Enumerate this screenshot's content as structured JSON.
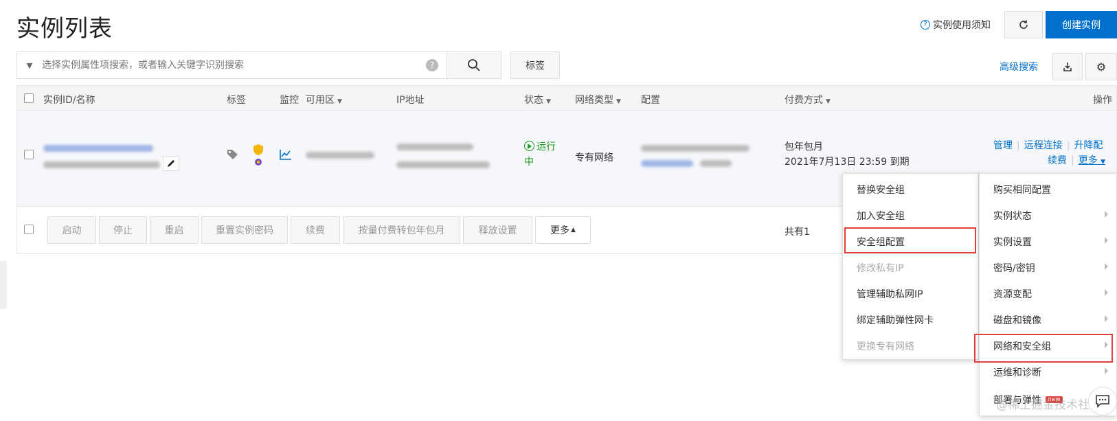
{
  "page": {
    "title": "实例列表"
  },
  "header": {
    "notice_label": "实例使用须知",
    "create_label": "创建实例"
  },
  "toolbar": {
    "search_placeholder": "选择实例属性项搜索，或者输入关键字识别搜索",
    "tag_label": "标签",
    "advanced_search_label": "高级搜索"
  },
  "table": {
    "columns": {
      "id_name": "实例ID/名称",
      "tags": "标签",
      "monitor": "监控",
      "zone": "可用区",
      "ip": "IP地址",
      "status": "状态",
      "network_type": "网络类型",
      "config": "配置",
      "billing": "付费方式",
      "actions": "操作"
    },
    "row": {
      "status": "运行中",
      "network_type": "专有网络",
      "billing_type": "包年包月",
      "expire_text": "2021年7月13日 23:59 到期",
      "actions": {
        "manage": "管理",
        "remote": "远程连接",
        "upgrade": "升降配",
        "renew": "续费",
        "more": "更多"
      }
    },
    "total_text": "共有1"
  },
  "batch_actions": {
    "start": "启动",
    "stop": "停止",
    "restart": "重启",
    "reset_password": "重置实例密码",
    "renew": "续费",
    "convert_billing": "按量付费转包年包月",
    "release": "释放设置",
    "more": "更多"
  },
  "more_menu": {
    "items": [
      "购买相同配置",
      "实例状态",
      "实例设置",
      "密码/密钥",
      "资源变配",
      "磁盘和镜像",
      "网络和安全组",
      "运维和诊断",
      "部署与弹性"
    ],
    "new_badge": "new"
  },
  "sub_menu": {
    "items": [
      "替换安全组",
      "加入安全组",
      "安全组配置",
      "修改私有IP",
      "管理辅助私网IP",
      "绑定辅助弹性网卡",
      "更换专有网络"
    ]
  },
  "watermark": "@稀土掘金技术社区",
  "colors": {
    "primary": "#0070cc",
    "running": "#1a9a1a",
    "highlight": "#e0413a"
  }
}
